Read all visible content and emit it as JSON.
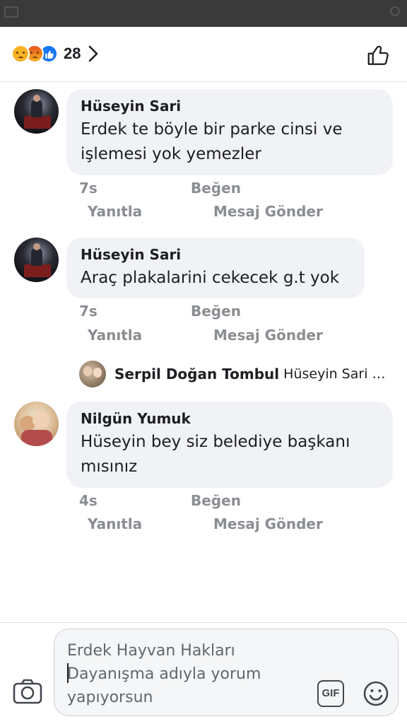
{
  "reactions": {
    "count": "28",
    "types": [
      "sad",
      "angry",
      "like"
    ]
  },
  "comments": [
    {
      "author": "Hüseyin Sari",
      "text": "Erdek te böyle bir parke cinsi ve işlemesi yok yemezler",
      "time": "7s",
      "like": "Beğen",
      "reply": "Yanıtla",
      "message": "Mesaj Gönder"
    },
    {
      "author": "Hüseyin Sari",
      "text": "Araç plakalarini cekecek g.t yok",
      "time": "7s",
      "like": "Beğen",
      "reply": "Yanıtla",
      "message": "Mesaj Gönder",
      "reply_preview": {
        "author": "Serpil Doğan Tombul",
        "text": "Hüseyin Sari N..."
      }
    },
    {
      "author": "Nilgün Yumuk",
      "text": "Hüseyin bey siz belediye başkanı mısınız",
      "time": "4s",
      "like": "Beğen",
      "reply": "Yanıtla",
      "message": "Mesaj Gönder"
    }
  ],
  "composer": {
    "placeholder": "Erdek Hayvan Hakları Dayanışma adıyla yorum yapıyorsun",
    "gif_label": "GIF"
  },
  "colors": {
    "bubble": "#f0f2f5",
    "meta": "#8a8d91",
    "like": "#1877f2"
  }
}
